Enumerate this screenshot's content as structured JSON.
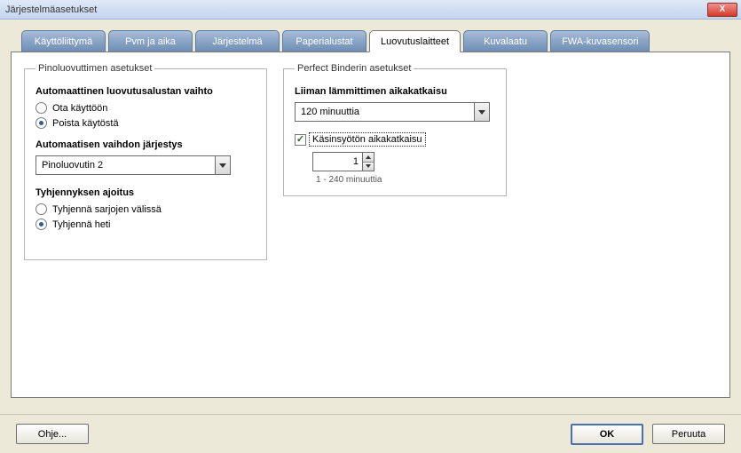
{
  "window": {
    "title": "Järjestelmäasetukset"
  },
  "tabs": {
    "ui": "Käyttöliittymä",
    "datetime": "Pvm ja aika",
    "system": "Järjestelmä",
    "trays": "Paperialustat",
    "output": "Luovutuslaitteet",
    "quality": "Kuvalaatu",
    "sensor": "FWA-kuvasensori"
  },
  "stacker": {
    "legend": "Pinoluovuttimen asetukset",
    "auto_switch_title": "Automaattinen luovutusalustan vaihto",
    "enable": "Ota käyttöön",
    "disable": "Poista käytöstä",
    "auto_switch_selected": "disable",
    "order_title": "Automaatisen vaihdon järjestys",
    "order_value": "Pinoluovutin 2",
    "unload_title": "Tyhjennyksen ajoitus",
    "unload_between": "Tyhjennä sarjojen välissä",
    "unload_now": "Tyhjennä heti",
    "unload_selected": "now"
  },
  "binder": {
    "legend": "Perfect Binderin asetukset",
    "glue_title": "Liiman lämmittimen aikakatkaisu",
    "glue_value": "120 minuuttia",
    "manual_label": "Käsinsyötön aikakatkaisu",
    "manual_checked": true,
    "manual_value": "1",
    "manual_hint": "1 - 240 minuuttia"
  },
  "footer": {
    "help": "Ohje...",
    "ok": "OK",
    "cancel": "Peruuta"
  }
}
